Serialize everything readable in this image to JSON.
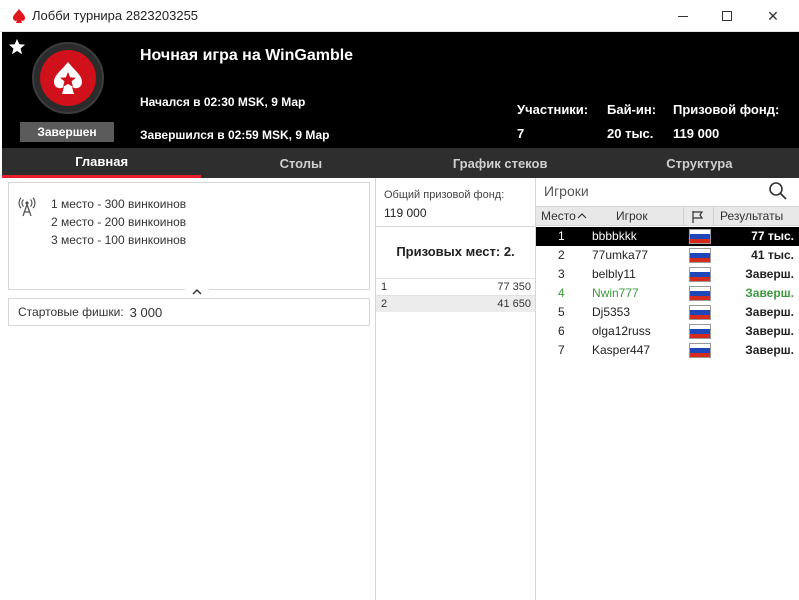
{
  "window": {
    "title": "Лобби турнира 2823203255",
    "controls": {
      "min": "minimize",
      "max": "maximize",
      "close": "✕"
    }
  },
  "header": {
    "status": "Завершен",
    "name": "Ночная игра на WinGamble",
    "started": "Начался в 02:30 MSK, 9 Мар",
    "ended": "Завершился в 02:59 MSK, 9 Мар",
    "stats": [
      {
        "label": "Участники:",
        "value": "7"
      },
      {
        "label": "Бай-ин:",
        "value": "20 тыс."
      },
      {
        "label": "Призовой фонд:",
        "value": "119 000"
      }
    ]
  },
  "tabs": [
    {
      "label": "Главная",
      "active": true
    },
    {
      "label": "Столы",
      "active": false
    },
    {
      "label": "График стеков",
      "active": false
    },
    {
      "label": "Структура",
      "active": false
    }
  ],
  "prizes": [
    "1 место - 300 винкоинов",
    "2 место - 200 винкоинов",
    "3 место - 100 винкоинов"
  ],
  "chips": {
    "label": "Стартовые фишки:",
    "value": "3 000"
  },
  "pool": {
    "label": "Общий призовой фонд:",
    "value": "119 000",
    "places": "Призовых мест: 2.",
    "payouts": [
      {
        "place": "1",
        "amount": "77 350"
      },
      {
        "place": "2",
        "amount": "41 650"
      }
    ]
  },
  "players": {
    "title": "Игроки",
    "columns": {
      "place": "Место",
      "player": "Игрок",
      "results": "Результаты"
    },
    "rows": [
      {
        "place": "1",
        "name": "bbbbkkk",
        "result": "77 тыс."
      },
      {
        "place": "2",
        "name": "77umka77",
        "result": "41 тыс."
      },
      {
        "place": "3",
        "name": "belbly11",
        "result": "Заверш."
      },
      {
        "place": "4",
        "name": "Nwin777",
        "result": "Заверш."
      },
      {
        "place": "5",
        "name": "Dj5353",
        "result": "Заверш."
      },
      {
        "place": "6",
        "name": "olga12russ",
        "result": "Заверш."
      },
      {
        "place": "7",
        "name": "Kasper447",
        "result": "Заверш."
      }
    ]
  },
  "colors": {
    "accent": "#e8202c",
    "header_bg": "#000000",
    "highlight": "#3c9a3c"
  }
}
